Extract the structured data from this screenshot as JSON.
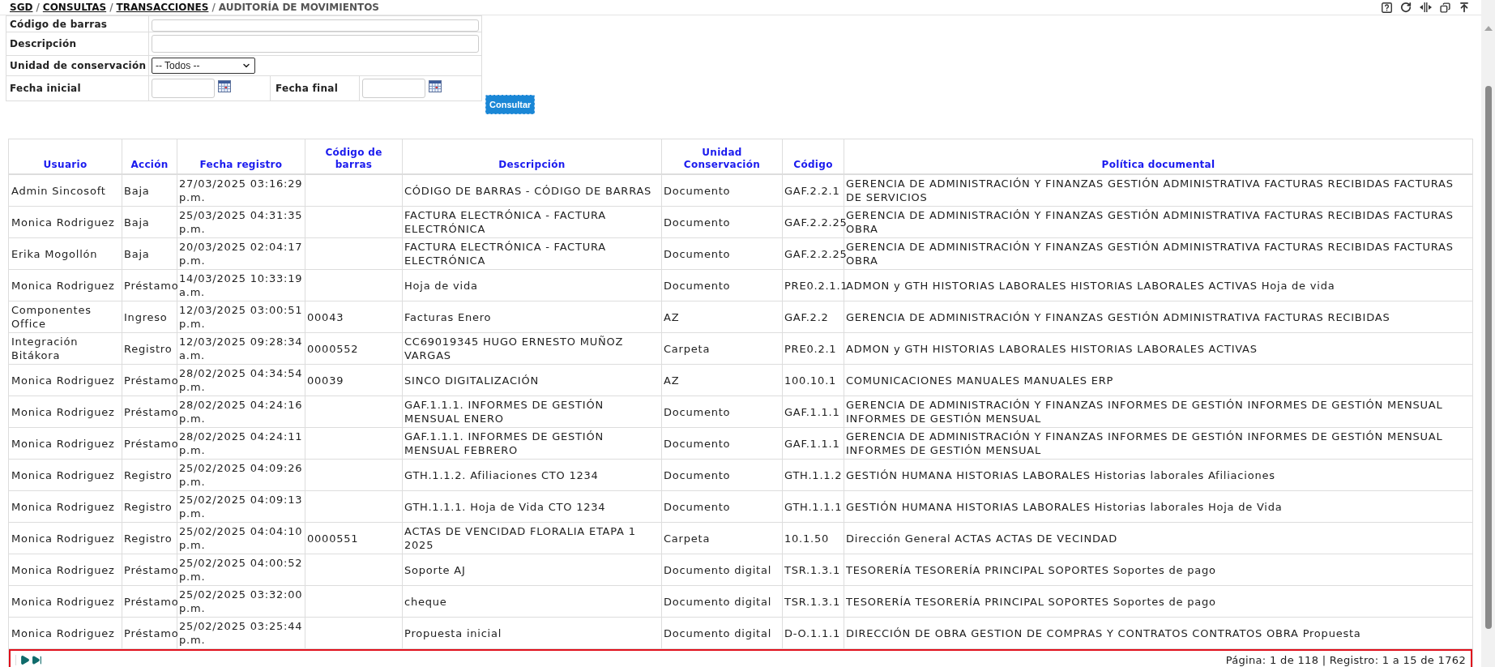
{
  "breadcrumb": [
    {
      "label": "SGD",
      "kind": "link"
    },
    {
      "label": "/",
      "kind": "separator"
    },
    {
      "label": "CONSULTAS",
      "kind": "link"
    },
    {
      "label": "/",
      "kind": "separator"
    },
    {
      "label": "TRANSACCIONES",
      "kind": "link"
    },
    {
      "label": "/",
      "kind": "separator"
    },
    {
      "label": "AUDITORÍA DE MOVIMIENTOS",
      "kind": "current"
    }
  ],
  "filters": {
    "barcode_label": "Código de barras",
    "description_label": "Descripción",
    "unit_label": "Unidad de conservación",
    "unit_value": "-- Todos --",
    "start_label": "Fecha inicial",
    "end_label": "Fecha final",
    "submit": "Consultar"
  },
  "table": {
    "columns": [
      "Usuario",
      "Acción",
      "Fecha registro",
      "Código de barras",
      "Descripción",
      "Unidad Conservación",
      "Código",
      "Política documental"
    ],
    "rows": [
      [
        "Admin Sincosoft",
        "Baja",
        "27/03/2025 03:16:29 p.m.",
        "",
        "CÓDIGO DE BARRAS - CÓDIGO DE BARRAS",
        "Documento",
        "GAF.2.2.1",
        "GERENCIA DE ADMINISTRACIÓN Y FINANZAS GESTIÓN ADMINISTRATIVA FACTURAS RECIBIDAS FACTURAS DE SERVICIOS"
      ],
      [
        "Monica Rodriguez",
        "Baja",
        "25/03/2025 04:31:35 p.m.",
        "",
        "FACTURA ELECTRÓNICA - FACTURA ELECTRÓNICA",
        "Documento",
        "GAF.2.2.25",
        "GERENCIA DE ADMINISTRACIÓN Y FINANZAS GESTIÓN ADMINISTRATIVA FACTURAS RECIBIDAS FACTURAS OBRA"
      ],
      [
        "Erika Mogollón",
        "Baja",
        "20/03/2025 02:04:17 p.m.",
        "",
        "FACTURA ELECTRÓNICA - FACTURA ELECTRÓNICA",
        "Documento",
        "GAF.2.2.25",
        "GERENCIA DE ADMINISTRACIÓN Y FINANZAS GESTIÓN ADMINISTRATIVA FACTURAS RECIBIDAS FACTURAS OBRA"
      ],
      [
        "Monica Rodriguez",
        "Préstamo",
        "14/03/2025 10:33:19 a.m.",
        "",
        "Hoja de vida",
        "Documento",
        "PRE0.2.1.1",
        "ADMON y GTH HISTORIAS LABORALES HISTORIAS LABORALES ACTIVAS Hoja de vida"
      ],
      [
        "Componentes Office",
        "Ingreso",
        "12/03/2025 03:00:51 p.m.",
        "00043",
        "Facturas Enero",
        "AZ",
        "GAF.2.2",
        "GERENCIA DE ADMINISTRACIÓN Y FINANZAS GESTIÓN ADMINISTRATIVA FACTURAS RECIBIDAS"
      ],
      [
        "Integración Bitákora",
        "Registro",
        "12/03/2025 09:28:34 a.m.",
        "0000552",
        "CC69019345 HUGO ERNESTO MUÑOZ VARGAS",
        "Carpeta",
        "PRE0.2.1",
        "ADMON y GTH HISTORIAS LABORALES HISTORIAS LABORALES ACTIVAS"
      ],
      [
        "Monica Rodriguez",
        "Préstamo",
        "28/02/2025 04:34:54 p.m.",
        "00039",
        "SINCO DIGITALIZACIÓN",
        "AZ",
        "100.10.1",
        "COMUNICACIONES MANUALES MANUALES ERP"
      ],
      [
        "Monica Rodriguez",
        "Préstamo",
        "28/02/2025 04:24:16 p.m.",
        "",
        "GAF.1.1.1. INFORMES DE GESTIÓN MENSUAL ENERO",
        "Documento",
        "GAF.1.1.1",
        "GERENCIA DE ADMINISTRACIÓN Y FINANZAS INFORMES DE GESTIÓN INFORMES DE GESTIÓN MENSUAL INFORMES DE GESTIÓN MENSUAL"
      ],
      [
        "Monica Rodriguez",
        "Préstamo",
        "28/02/2025 04:24:11 p.m.",
        "",
        "GAF.1.1.1. INFORMES DE GESTIÓN MENSUAL FEBRERO",
        "Documento",
        "GAF.1.1.1",
        "GERENCIA DE ADMINISTRACIÓN Y FINANZAS INFORMES DE GESTIÓN INFORMES DE GESTIÓN MENSUAL INFORMES DE GESTIÓN MENSUAL"
      ],
      [
        "Monica Rodriguez",
        "Registro",
        "25/02/2025 04:09:26 p.m.",
        "",
        "GTH.1.1.2. Afiliaciones CTO 1234",
        "Documento",
        "GTH.1.1.2",
        "GESTIÓN HUMANA HISTORIAS LABORALES Historias laborales Afiliaciones"
      ],
      [
        "Monica Rodriguez",
        "Registro",
        "25/02/2025 04:09:13 p.m.",
        "",
        "GTH.1.1.1. Hoja de Vida CTO 1234",
        "Documento",
        "GTH.1.1.1",
        "GESTIÓN HUMANA HISTORIAS LABORALES Historias laborales Hoja de Vida"
      ],
      [
        "Monica Rodriguez",
        "Registro",
        "25/02/2025 04:04:10 p.m.",
        "0000551",
        "ACTAS DE VENCIDAD FLORALIA ETAPA 1 2025",
        "Carpeta",
        "10.1.50",
        "Dirección General ACTAS ACTAS DE VECINDAD"
      ],
      [
        "Monica Rodriguez",
        "Préstamo",
        "25/02/2025 04:00:52 p.m.",
        "",
        "Soporte AJ",
        "Documento digital",
        "TSR.1.3.1",
        "TESORERÍA TESORERÍA PRINCIPAL SOPORTES Soportes de pago"
      ],
      [
        "Monica Rodriguez",
        "Préstamo",
        "25/02/2025 03:32:00 p.m.",
        "",
        "cheque",
        "Documento digital",
        "TSR.1.3.1",
        "TESORERÍA TESORERÍA PRINCIPAL SOPORTES Soportes de pago"
      ],
      [
        "Monica Rodriguez",
        "Préstamo",
        "25/02/2025 03:25:44 p.m.",
        "",
        "Propuesta inicial",
        "Documento digital",
        "D-O.1.1.1",
        "DIRECCIÓN DE OBRA GESTION DE COMPRAS Y CONTRATOS CONTRATOS OBRA Propuesta"
      ]
    ]
  },
  "pager": {
    "summary": "Página: 1 de 118 | Registro: 1 a 15 de 1762"
  }
}
